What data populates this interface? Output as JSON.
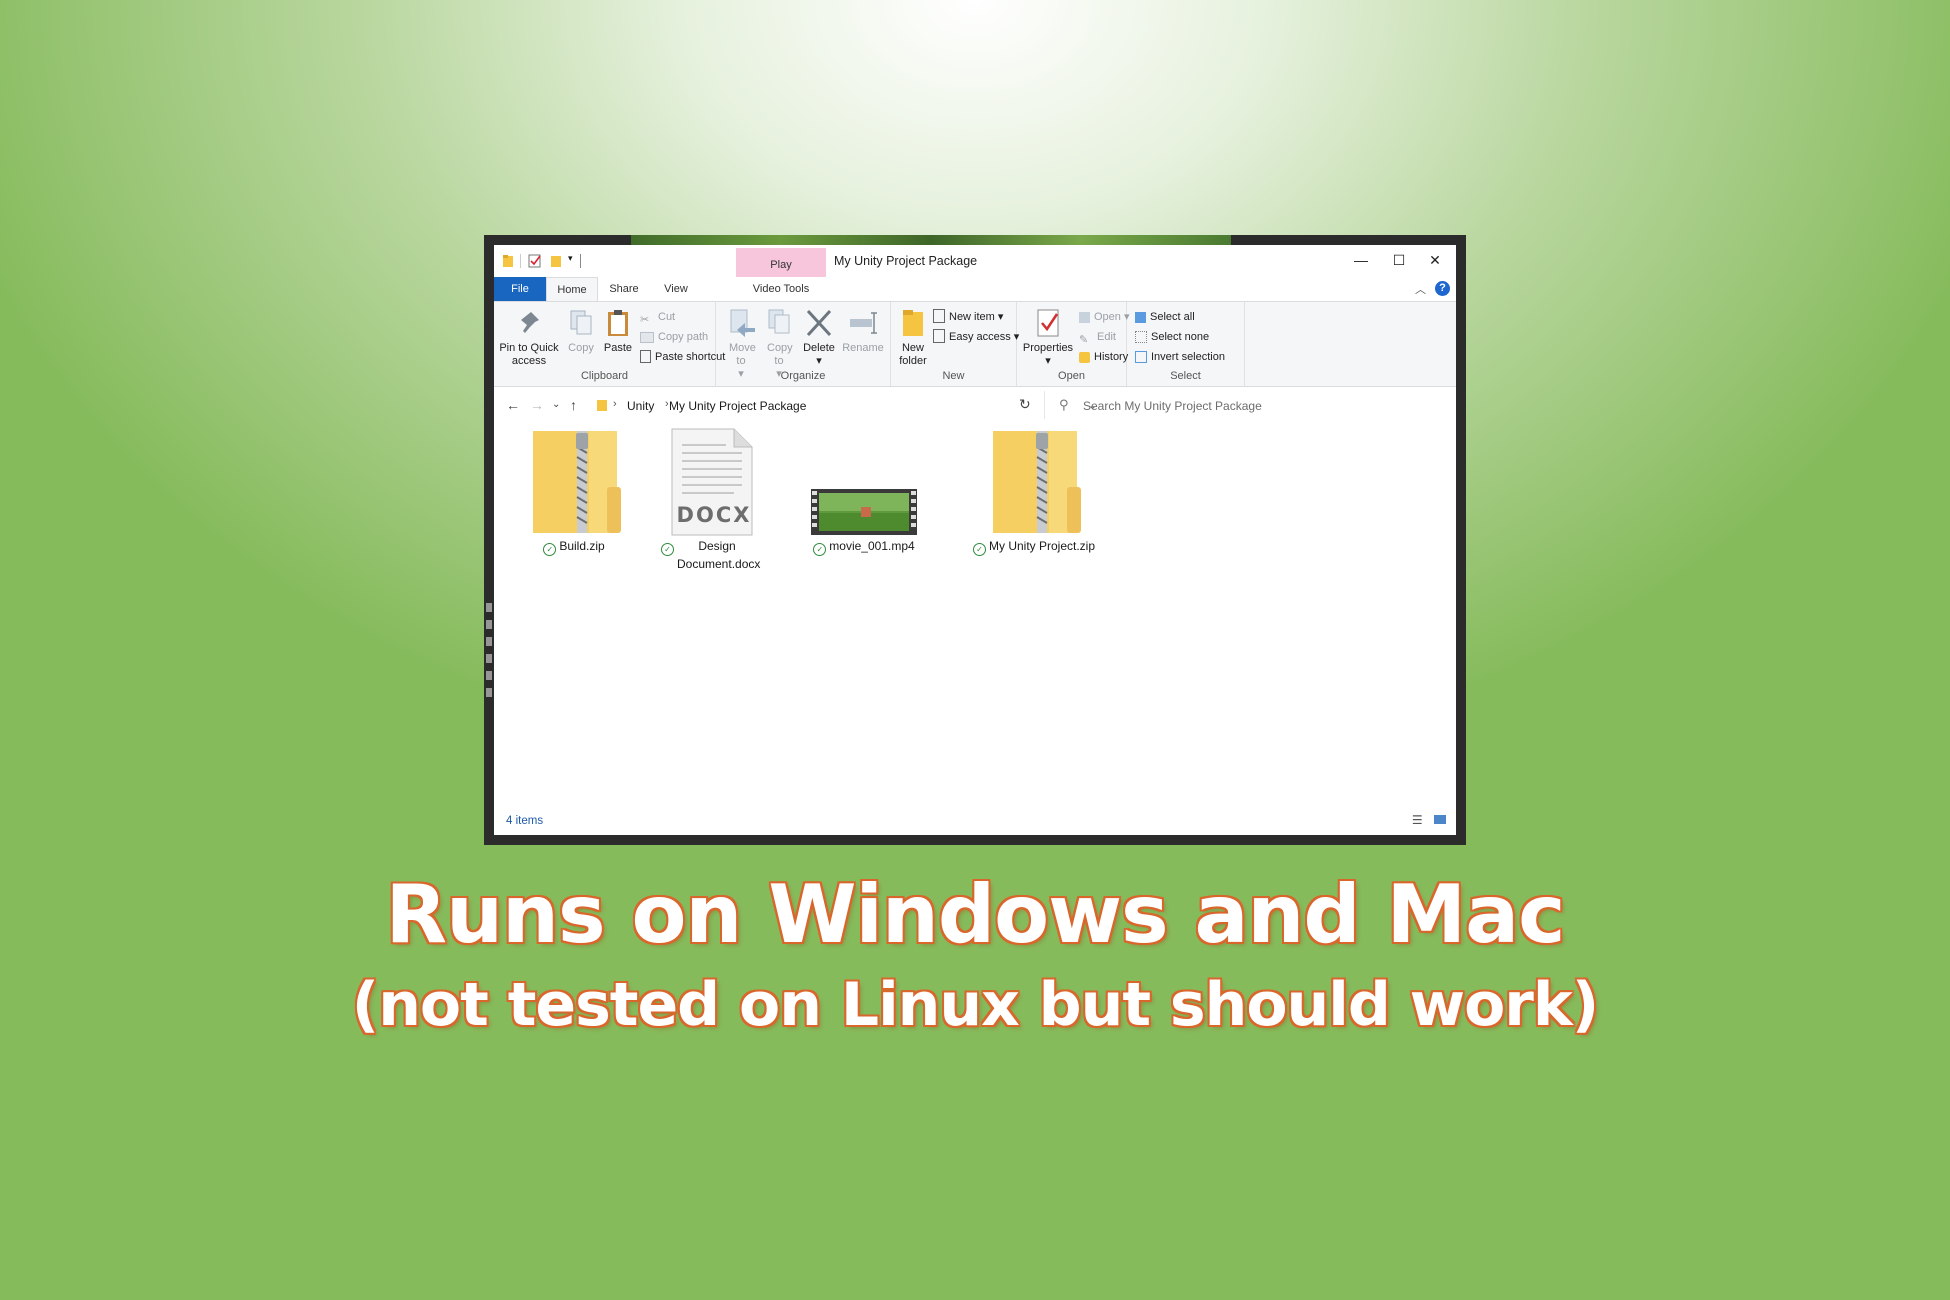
{
  "window": {
    "title": "My Unity Project Package",
    "context_tab": "Play",
    "minimize": "—",
    "maximize": "☐",
    "close": "✕"
  },
  "tabs": {
    "file": "File",
    "home": "Home",
    "share": "Share",
    "view": "View",
    "video_tools": "Video Tools"
  },
  "ribbon": {
    "clipboard": {
      "label": "Clipboard",
      "pin": "Pin to Quick access",
      "copy": "Copy",
      "paste": "Paste",
      "cut": "Cut",
      "copy_path": "Copy path",
      "paste_shortcut": "Paste shortcut"
    },
    "organize": {
      "label": "Organize",
      "move_to": "Move to",
      "copy_to": "Copy to",
      "delete": "Delete",
      "rename": "Rename"
    },
    "new": {
      "label": "New",
      "new_folder": "New folder",
      "new_item": "New item",
      "easy_access": "Easy access"
    },
    "open": {
      "label": "Open",
      "properties": "Properties",
      "open": "Open",
      "edit": "Edit",
      "history": "History"
    },
    "select": {
      "label": "Select",
      "select_all": "Select all",
      "select_none": "Select none",
      "invert": "Invert selection"
    }
  },
  "address": {
    "crumbs": [
      "Unity",
      "My Unity Project Package"
    ],
    "search_placeholder": "Search My Unity Project Package"
  },
  "files": [
    {
      "name": "Build.zip",
      "icon": "zip-folder-icon"
    },
    {
      "name": "Design Document.docx",
      "icon": "docx-icon",
      "icon_text": "DOCX"
    },
    {
      "name": "movie_001.mp4",
      "icon": "video-thumbnail-icon"
    },
    {
      "name": "My Unity Project.zip",
      "icon": "zip-folder-icon"
    }
  ],
  "status": {
    "count": "4 items"
  },
  "captions": {
    "main": "Runs on Windows and Mac",
    "sub": "(not tested on Linux but should work)"
  },
  "colors": {
    "accent": "#1966c0",
    "caption_outline": "#d9662b",
    "sync_check": "#2e8b3c",
    "context_tab": "#f7c6dd"
  }
}
